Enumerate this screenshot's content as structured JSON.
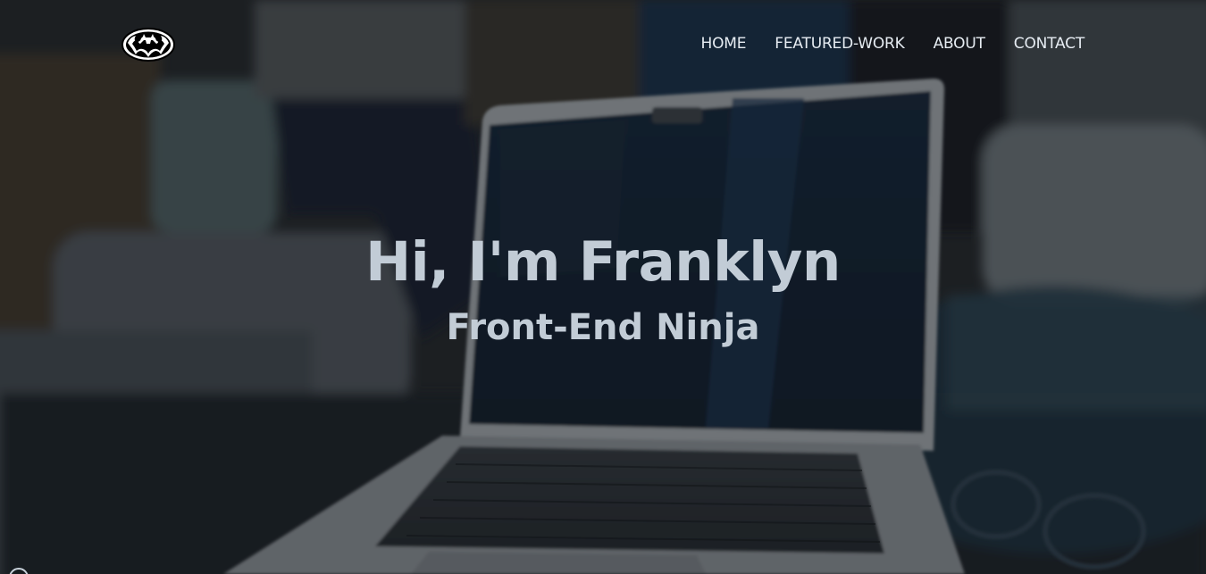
{
  "nav": {
    "logo": "batman-logo",
    "links": [
      {
        "label": "HOME"
      },
      {
        "label": "FEATURED-WORK"
      },
      {
        "label": "ABOUT"
      },
      {
        "label": "CONTACT"
      }
    ]
  },
  "hero": {
    "title": "Hi, I'm Franklyn",
    "subtitle": "Front-End Ninja"
  },
  "colors": {
    "nav_text": "#e6ecf2",
    "hero_text": "#c2ccd6",
    "overlay": "#0a0e14"
  }
}
